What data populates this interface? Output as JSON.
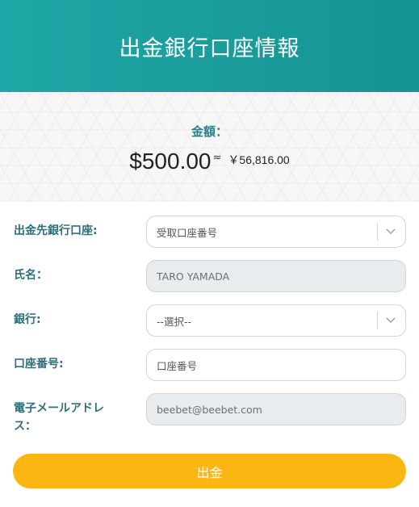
{
  "header": {
    "title": "出金銀行口座情報"
  },
  "amount": {
    "label": "金額：",
    "usd": "$500.00",
    "approx": "≈",
    "jpy": "￥56,816.00"
  },
  "form": {
    "bank_account": {
      "label": "出金先銀行口座:",
      "selected": "受取口座番号",
      "icon": "chevron-down-icon"
    },
    "name": {
      "label": "氏名：",
      "value": "TARO YAMADA"
    },
    "bank": {
      "label": "銀行:",
      "selected": "--選択--",
      "icon": "chevron-down-icon"
    },
    "account_number": {
      "label": "口座番号:",
      "placeholder": "口座番号"
    },
    "email": {
      "label_line1": "電子メールアドレ",
      "label_line2": "ス：",
      "value": "beebet@beebet.com"
    }
  },
  "submit": {
    "label": "出金"
  },
  "colors": {
    "header": "#1ea7a6",
    "label": "#2f6f7a",
    "submit": "#fbb614"
  }
}
